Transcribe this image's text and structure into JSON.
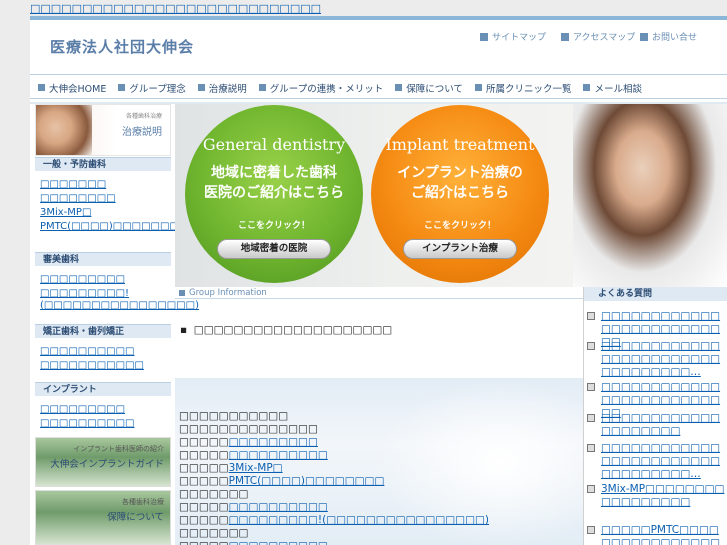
{
  "top_link": "□□□□□□□□□□□□□□□□□□□□□□□□□□□□",
  "header": {
    "logo": "医療法人社団大伸会",
    "util": [
      "サイトマップ",
      "アクセスマップ",
      "お問い合せ"
    ]
  },
  "nav": [
    "大伸会HOME",
    "グループ理念",
    "治療説明",
    "グループの連携・メリット",
    "保障について",
    "所属クリニック一覧",
    "メール相談"
  ],
  "sidebar": {
    "banner1": {
      "small": "各種歯科治療",
      "title": "治療説明"
    },
    "sections": [
      {
        "head": "一般・予防歯科",
        "links": [
          "□□□□□□□",
          "□□□□□□□□",
          "3Mix-MP□",
          "PMTC(□□□□)□□□□□□□□"
        ]
      },
      {
        "head": "審美歯科",
        "links": [
          "□□□□□□□□□",
          "□□□□□□□□□!(□□□□□□□□□□□□□□□□)"
        ]
      },
      {
        "head": "矯正歯科・歯列矯正",
        "links": [
          "□□□□□□□□□□",
          "□□□□□□□□□□□"
        ]
      },
      {
        "head": "インプラント",
        "links": [
          "□□□□□□□□□",
          "□□□□□□□□□□"
        ]
      }
    ],
    "banner2": {
      "small": "インプラント歯科医師の紹介",
      "title": "大伸会インプラントガイド"
    },
    "banner3": {
      "small": "各種歯科治療",
      "title": "保障について"
    }
  },
  "hero": {
    "left": {
      "en": "General dentistry",
      "jp1": "地域に密着した歯科",
      "jp2": "医院のご紹介はこちら",
      "click": "ここをクリック！",
      "button": "地域密着の医院"
    },
    "right": {
      "en": "Implant treatment",
      "jp1": "インプラント治療の",
      "jp2": "ご紹介はこちら",
      "click": "ここをクリック！",
      "button": "インプラント治療"
    }
  },
  "group_info": "Group Information",
  "notice": "□□□□□□□□□□□□□□□□□□□□",
  "main_lines": [
    {
      "a": "□□□□□□□□□□□",
      "b": ""
    },
    {
      "a": "□□□□□□□□□□□□□□",
      "b": ""
    },
    {
      "a": "□□□□□",
      "b": "□□□□□□□□□"
    },
    {
      "a": "□□□□□",
      "b": "□□□□□□□□□□"
    },
    {
      "a": "□□□□□",
      "b": "3Mix-MP□"
    },
    {
      "a": "□□□□□",
      "b": "PMTC(□□□□)□□□□□□□□"
    },
    {
      "a": "□□□□□□□",
      "b": ""
    },
    {
      "a": "□□□□□",
      "b": "□□□□□□□□□□"
    },
    {
      "a": "□□□□□",
      "b": "□□□□□□□□□!(□□□□□□□□□□□□□□□□)"
    },
    {
      "a": "□□□□□□□",
      "b": ""
    },
    {
      "a": "□□□□□",
      "b": "□□□□□□□□□□"
    },
    {
      "a": "□□□□□",
      "b": "□□□□□□□□□□□□"
    }
  ],
  "faq": {
    "head": "よくある質問",
    "items": [
      "□□□□□□□□□□□□□□□□□□□□□□□□□□",
      "□□□□□□□□□□□□□□□□□□□□□□□□□□□□□□□□□…",
      "□□□□□□□□□□□□□□□□□□□□□□□□□□",
      "□□□□□□□□□□□□□□□□□□□□",
      "□□□□□□□□□□□□□□□□□□□□□□□□□□□□□□□□□…",
      "3Mix-MP□□□□□□□□□□□□□□□□□",
      "□□□□□PMTC□□□□□□□□□□□□□□□□□"
    ]
  }
}
